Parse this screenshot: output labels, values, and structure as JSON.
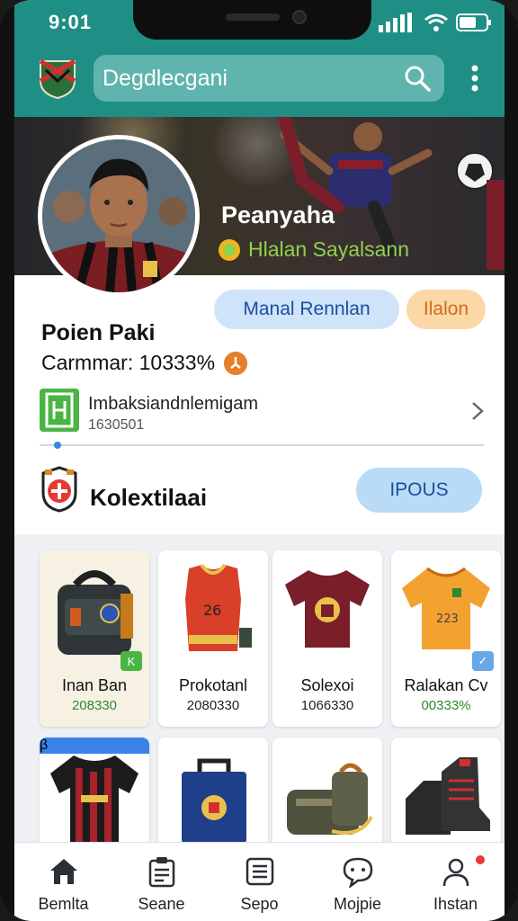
{
  "status": {
    "time": "9:01"
  },
  "header": {
    "search_text": "Degdlecgani"
  },
  "hero": {
    "player_name": "Peanyaha",
    "player_subtitle": "Hlalan Sayalsann"
  },
  "profile": {
    "follow_label": "Manal Rennlan",
    "chat_label": "Ilalon",
    "name": "Poien Paki",
    "stat": "Carmmar: 10333%"
  },
  "fan_row": {
    "title": "Imbaksiandnlemigam",
    "count": "1630501",
    "progress": 0.04
  },
  "collection": {
    "title": "Kolextilaai",
    "button_label": "IPOUS"
  },
  "products": [
    {
      "name": "Inan Ban",
      "price": "208330",
      "icon": "backpack-icon",
      "tag": "K",
      "tag_color": "#4bb543"
    },
    {
      "name": "Prokotanl",
      "price": "2080330",
      "icon": "jersey-icon"
    },
    {
      "name": "Solexoi",
      "price": "1066330",
      "icon": "shirt-icon"
    },
    {
      "name": "Ralakan Cv",
      "price": "00333%",
      "icon": "jersey-icon",
      "tag": "✓",
      "tag_color": "#6aa7ea"
    }
  ],
  "products_row2": [
    {
      "icon": "jersey-icon",
      "tag": "β",
      "tag_color": "#3a82e8"
    },
    {
      "icon": "case-icon"
    },
    {
      "icon": "bag-icon"
    },
    {
      "icon": "boots-icon"
    }
  ],
  "bottom_nav": [
    {
      "label": "Bemlta",
      "icon": "home-icon"
    },
    {
      "label": "Seane",
      "icon": "clipboard-icon"
    },
    {
      "label": "Sepo",
      "icon": "list-icon"
    },
    {
      "label": "Mojpie",
      "icon": "chat-icon"
    },
    {
      "label": "Ihstan",
      "icon": "profile-icon"
    }
  ],
  "colors": {
    "teal": "#1f8f86",
    "accent_blue": "#1b4f9c",
    "price_green": "#2d8a2d"
  }
}
